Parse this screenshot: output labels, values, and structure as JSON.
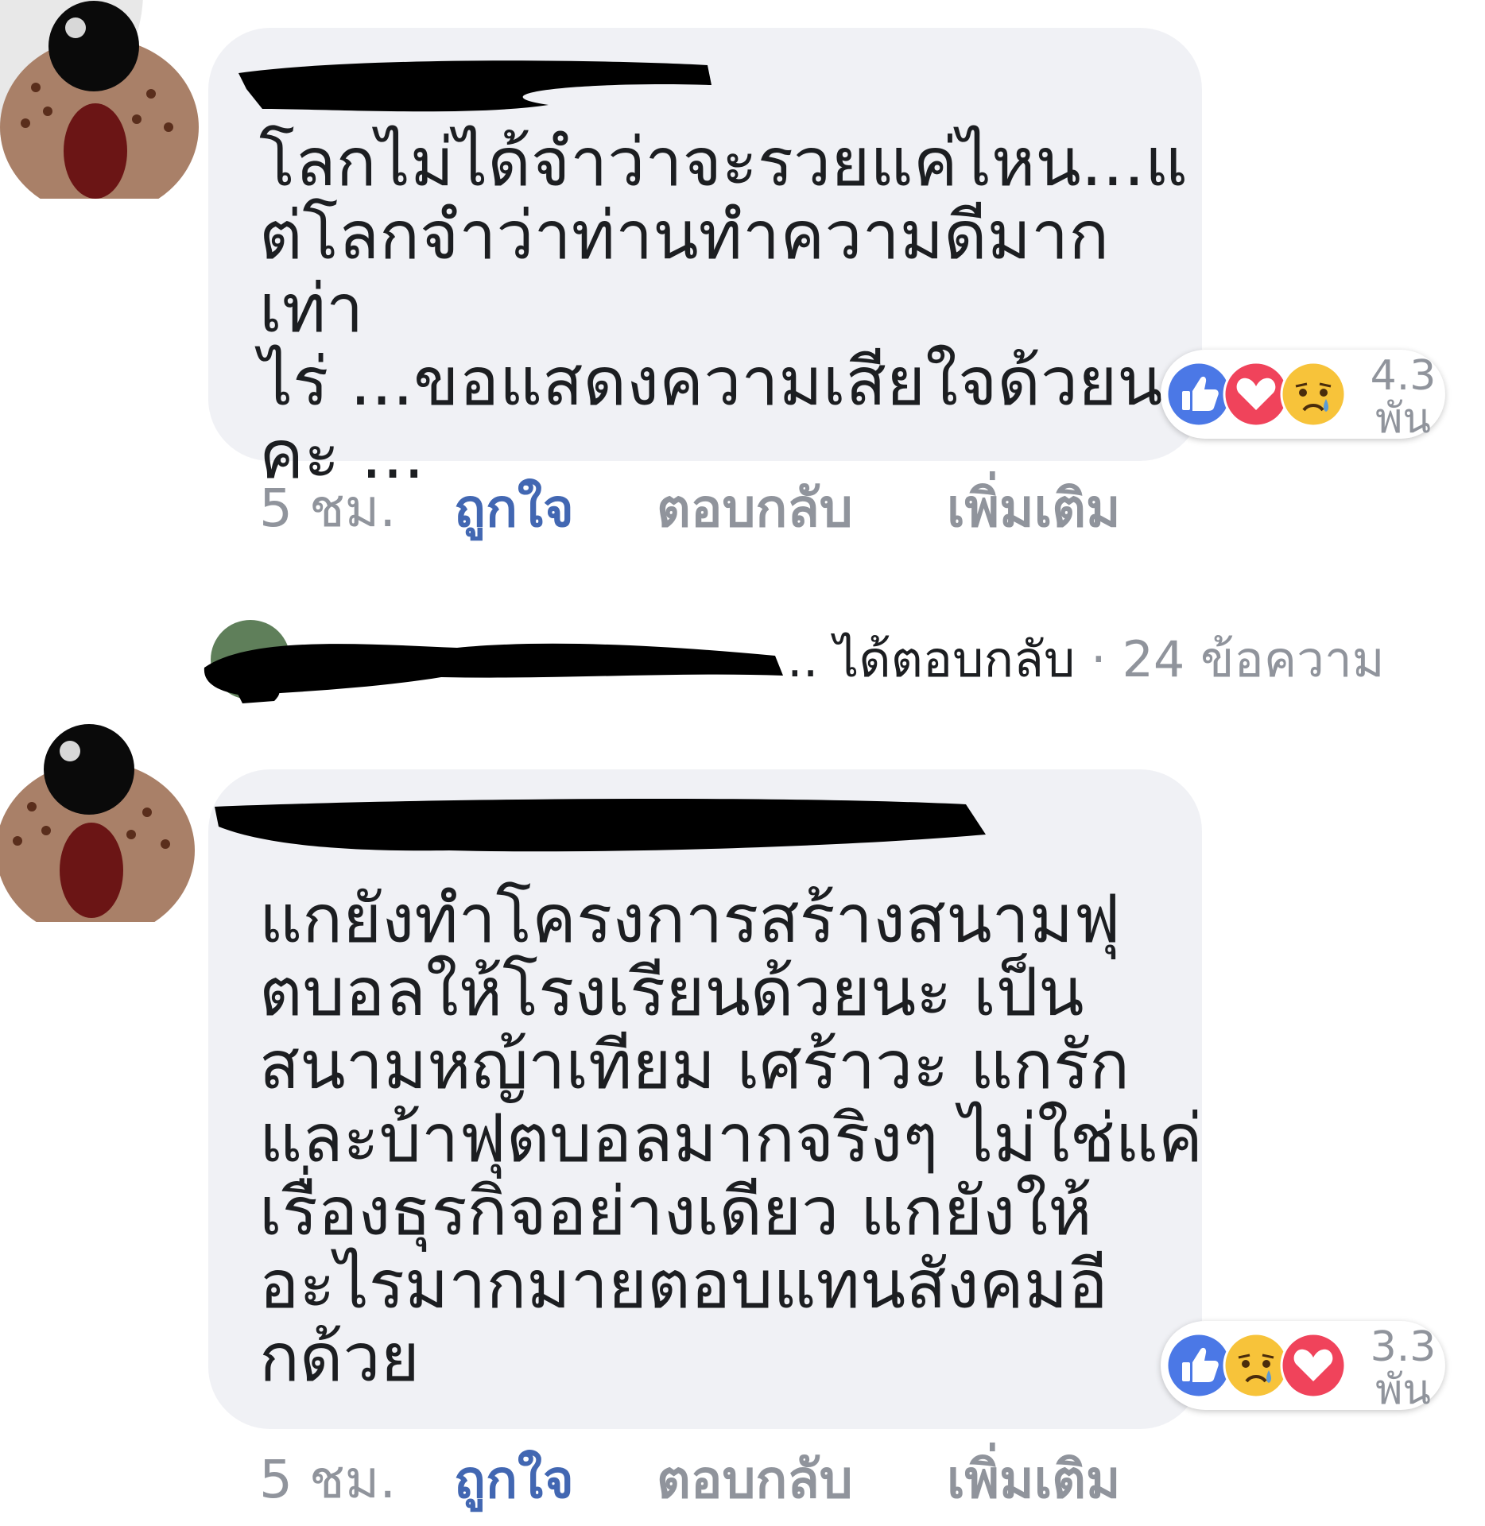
{
  "comments": [
    {
      "text": "โลกไม่ได้จำว่าจะรวยแค่ไหน...แ\nต่โลกจำว่าท่านทำความดีมากเท่า\nไร่ ...ขอแสดงความเสียใจด้วยนะ\nคะ ...",
      "reactions": [
        "like",
        "love",
        "sad"
      ],
      "reaction_count_num": "4.3",
      "reaction_count_unit": "พัน",
      "time": "5 ชม.",
      "like_label": "ถูกใจ",
      "reply_label": "ตอบกลับ",
      "more_label": "เพิ่มเติม"
    },
    {
      "text": "แกยังทำโครงการสร้างสนามฟุ\nตบอลให้โรงเรียนด้วยนะ เป็น\nสนามหญ้าเทียม เศร้าวะ แกรัก\nและบ้าฟุตบอลมากจริงๆ ไม่ใช่แค่\nเรื่องธุรกิจอย่างเดียว แกยังให้\nอะไรมากมายตอบแทนสังคมอี\nกด้วย",
      "reactions": [
        "like",
        "sad",
        "love"
      ],
      "reaction_count_num": "3.3",
      "reaction_count_unit": "พัน",
      "time": "5 ชม.",
      "like_label": "ถูกใจ",
      "reply_label": "ตอบกลับ",
      "more_label": "เพิ่มเติม"
    }
  ],
  "replies_summary": {
    "ellipsis": "..",
    "action": "ได้ตอบกลับ",
    "separator": " · ",
    "count": "24 ข้อความ"
  },
  "colors": {
    "bubble": "#f0f1f5",
    "link_blue": "#4267b2",
    "meta_gray": "#90949c",
    "like_blue": "#4b78e6",
    "love_red": "#f0435b",
    "sad_yellow": "#f7c33a"
  }
}
